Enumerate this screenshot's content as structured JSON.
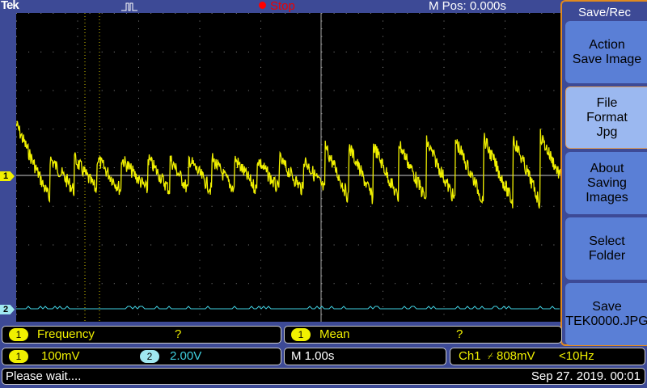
{
  "header": {
    "brand": "Tek",
    "run_state": "Stop",
    "m_pos": "M Pos: 0.000s"
  },
  "menu": {
    "title": "Save/Rec",
    "buttons": [
      {
        "lines": [
          "Action",
          "Save Image"
        ]
      },
      {
        "lines": [
          "File",
          "Format",
          "Jpg"
        ],
        "selected": true
      },
      {
        "lines": [
          "About",
          "Saving",
          "Images"
        ]
      },
      {
        "lines": [
          "Select",
          "Folder"
        ]
      },
      {
        "lines": [
          "Save",
          "TEK0000.JPG"
        ]
      }
    ]
  },
  "channels": {
    "ch1": {
      "num": "1",
      "scale": "100mV",
      "color": "#f0f000"
    },
    "ch2": {
      "num": "2",
      "scale": "2.00V",
      "color": "#40d0e0"
    }
  },
  "measurements": [
    {
      "ch": "1",
      "name": "Frequency",
      "value": "?"
    },
    {
      "ch": "1",
      "name": "Mean",
      "value": "?"
    }
  ],
  "timebase": "M 1.00s",
  "trigger": {
    "source": "Ch1",
    "slope": "⌿",
    "level": "808mV",
    "freq": "<10Hz"
  },
  "status": {
    "message": "Please wait....",
    "datetime": "Sep 27. 2019. 00:01"
  }
}
